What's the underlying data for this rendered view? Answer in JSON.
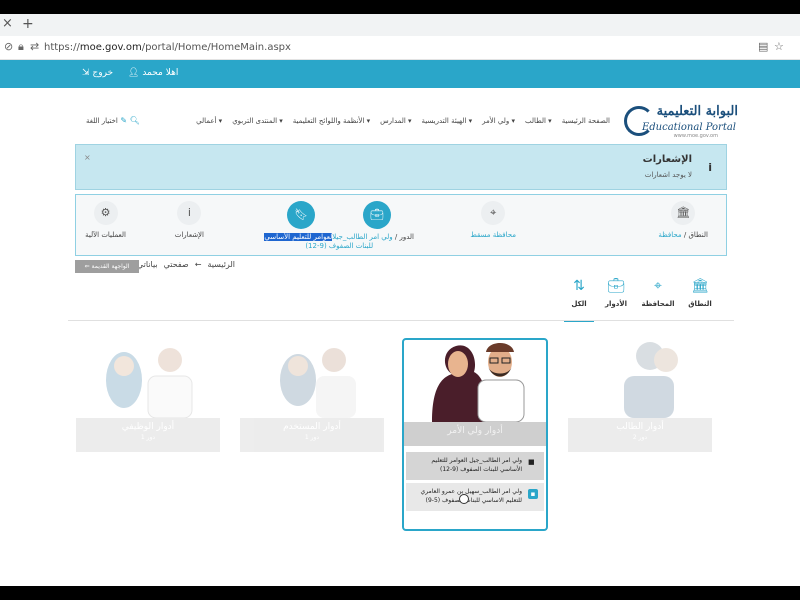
{
  "browser": {
    "tab_close": "×",
    "tab_new": "+",
    "url_host": "moe.gov.om",
    "url_prefix": "https://",
    "url_path": "/portal/Home/HomeMain.aspx"
  },
  "topbar": {
    "logout": "خروج",
    "greeting": "اهلا محمد"
  },
  "logo": {
    "arabic": "البوابة التعليمية",
    "english": "Educational Portal",
    "website": "www.moe.gov.om"
  },
  "menu": [
    "الصفحة الرئيسية",
    "الطالب ▾",
    "ولي الأمر ▾",
    "الهيئة التدريسية ▾",
    "المدارس ▾",
    "الأنظمة واللوائح التعليمية ▾",
    "المنتدى التربوي ▾",
    "أعمالي ▾"
  ],
  "menu_tools": "اختيار اللغة",
  "notifications": {
    "title": "الإشعارات",
    "empty": "لا يوجد اشعارات"
  },
  "scope": {
    "domain_label": "النطاق /",
    "domain_value": "محافظة",
    "governorate": "محافظة مسقط",
    "role_label": "الدور /",
    "role_value_hl": "العوامر للتعليم الأساسي",
    "role_value_prefix": "ولي امر الطالب_جيل",
    "role_value_line2": "للبنات الصفوف (9-12)",
    "notifications": "الإشعارات",
    "auto_ops": "العمليات الآلية"
  },
  "breadcrumb": {
    "home": "الرئيسية",
    "arrow": "←",
    "my_page": "صفحتي",
    "my_data": "بياناتي"
  },
  "old_version": "الواجهة القديمة",
  "filter_tabs": {
    "domain": "النطاق",
    "governorate": "المحافظة",
    "roles": "الأدوار",
    "all": "الكل"
  },
  "cards": {
    "student": {
      "title": "أدوار الطالب",
      "count": "2 دور"
    },
    "guardian": {
      "title": "أدوار ولي الأمر"
    },
    "user": {
      "title": "أدوار المستخدم",
      "count": "1 دور"
    },
    "employee": {
      "title": "أدوار الوظيفي",
      "count": "1 دور"
    }
  },
  "guardian_roles": [
    "ولي امر الطالب_جيل العوامر للتعليم الأساسي للبنات الصفوف (9-12)",
    "ولي امر الطالب_سهيل بن عمرو العامري للتعليم الاساسي للبنات الصفوف (5-9)"
  ]
}
